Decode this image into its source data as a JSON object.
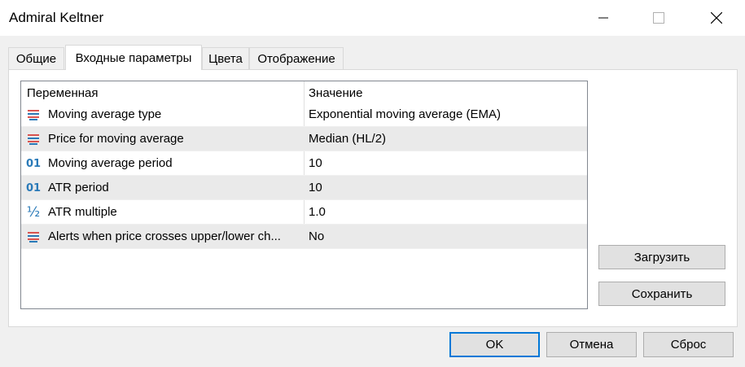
{
  "window": {
    "title": "Admiral Keltner",
    "minimize_icon": "minimize-icon",
    "maximize_icon": "maximize-icon",
    "close_icon": "close-icon"
  },
  "tabs": [
    {
      "label": "Общие",
      "active": false
    },
    {
      "label": "Входные параметры",
      "active": true
    },
    {
      "label": "Цвета",
      "active": false
    },
    {
      "label": "Отображение",
      "active": false
    }
  ],
  "grid": {
    "columns": {
      "variable": "Переменная",
      "value": "Значение"
    },
    "rows": [
      {
        "icon": "enum-icon",
        "name": "Moving average type",
        "value": "Exponential moving average (EMA)"
      },
      {
        "icon": "enum-icon",
        "name": "Price for moving average",
        "value": "Median (HL/2)"
      },
      {
        "icon": "integer-icon",
        "name": "Moving average period",
        "value": "10"
      },
      {
        "icon": "integer-icon",
        "name": "ATR period",
        "value": "10"
      },
      {
        "icon": "fraction-icon",
        "name": "ATR multiple",
        "value": "1.0"
      },
      {
        "icon": "enum-icon",
        "name": "Alerts when price crosses upper/lower ch...",
        "value": "No"
      }
    ]
  },
  "buttons": {
    "load": "Загрузить",
    "save": "Сохранить",
    "ok": "OK",
    "cancel": "Отмена",
    "reset": "Сброс"
  },
  "colors": {
    "accent": "#0078d7",
    "icon_blue": "#2a7ab8",
    "icon_red": "#d9534f"
  }
}
